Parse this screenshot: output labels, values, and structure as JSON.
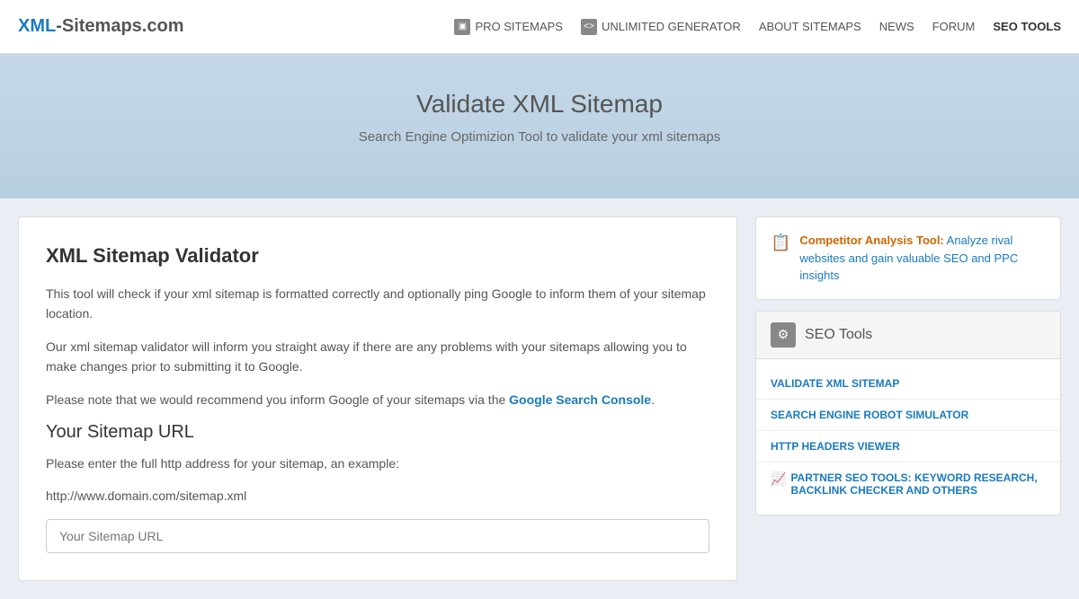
{
  "header": {
    "logo": {
      "xml": "XML",
      "rest": "-Sitemaps.com"
    },
    "nav": [
      {
        "id": "pro-sitemaps",
        "icon": "box-icon",
        "label": "PRO SITEMAPS",
        "hasIcon": true
      },
      {
        "id": "unlimited-generator",
        "icon": "code-icon",
        "label": "UNLIMITED GENERATOR",
        "hasIcon": true
      },
      {
        "id": "about-sitemaps",
        "icon": "",
        "label": "ABOUT SITEMAPS",
        "hasIcon": false
      },
      {
        "id": "news",
        "icon": "",
        "label": "NEWS",
        "hasIcon": false
      },
      {
        "id": "forum",
        "icon": "",
        "label": "FORUM",
        "hasIcon": false
      },
      {
        "id": "seo-tools",
        "icon": "",
        "label": "SEO TOOLS",
        "hasIcon": false
      }
    ]
  },
  "hero": {
    "title": "Validate XML Sitemap",
    "subtitle": "Search Engine Optimizion Tool to validate your xml sitemaps"
  },
  "main": {
    "validator": {
      "heading": "XML Sitemap Validator",
      "description1": "This tool will check if your xml sitemap is formatted correctly and optionally ping Google to inform them of your sitemap location.",
      "description2": "Our xml sitemap validator will inform you straight away if there are any problems with your sitemaps allowing you to make changes prior to submitting it to Google.",
      "description3_pre": "Please note that we would recommend you inform Google of your sitemaps via the ",
      "description3_link": "Google Search Console",
      "description3_post": ".",
      "sitemap_url_heading": "Your Sitemap URL",
      "sitemap_url_desc": "Please enter the full http address for your sitemap, an example:",
      "sitemap_url_example": "http://www.domain.com/sitemap.xml",
      "sitemap_url_placeholder": "Your Sitemap URL"
    },
    "competitor": {
      "label": "Competitor Analysis Tool:",
      "link_text": "Analyze rival websites and gain valuable SEO and PPC insights"
    },
    "seo_tools": {
      "heading": "SEO Tools",
      "links": [
        {
          "id": "validate-xml",
          "label": "VALIDATE XML SITEMAP",
          "partner": false
        },
        {
          "id": "robot-simulator",
          "label": "SEARCH ENGINE ROBOT SIMULATOR",
          "partner": false
        },
        {
          "id": "http-headers",
          "label": "HTTP HEADERS VIEWER",
          "partner": false
        },
        {
          "id": "partner-seo",
          "label": "PARTNER SEO TOOLS: KEYWORD RESEARCH, BACKLINK CHECKER AND OTHERS",
          "partner": true
        }
      ]
    }
  }
}
